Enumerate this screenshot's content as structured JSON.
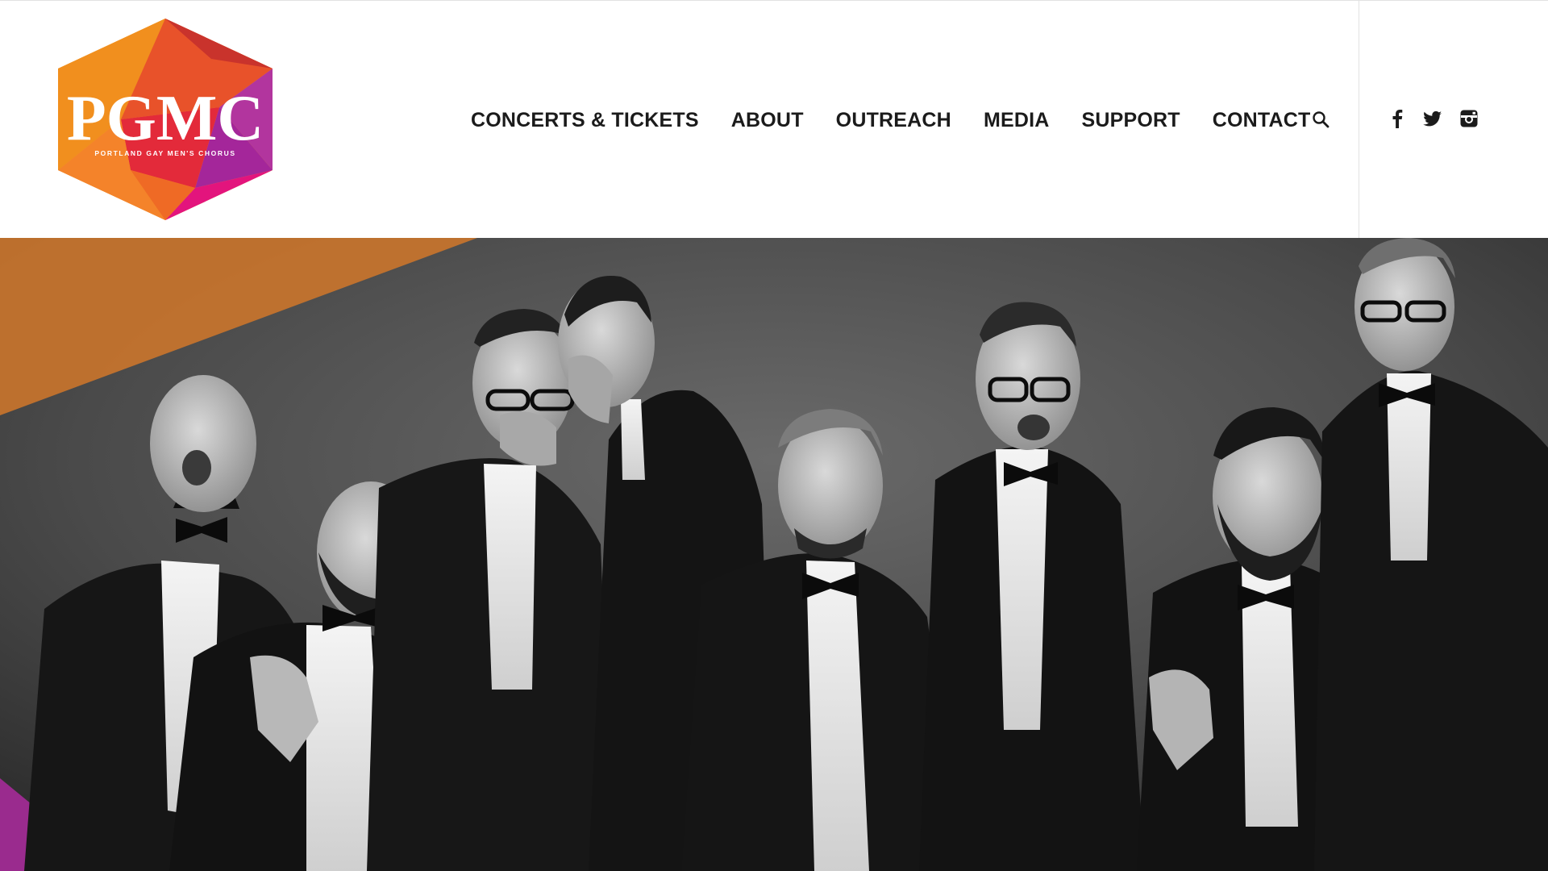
{
  "brand": {
    "logo_text": "PGMC",
    "logo_subtext": "PORTLAND GAY MEN'S CHORUS"
  },
  "nav": {
    "items": [
      {
        "label": "CONCERTS & TICKETS"
      },
      {
        "label": "ABOUT"
      },
      {
        "label": "OUTREACH"
      },
      {
        "label": "MEDIA"
      },
      {
        "label": "SUPPORT"
      },
      {
        "label": "CONTACT"
      }
    ],
    "search_icon": "search-icon"
  },
  "social": {
    "icons": [
      "facebook-icon",
      "twitter-icon",
      "instagram-icon"
    ]
  },
  "hero": {
    "image": "black-and-white group photo of eight men in tuxedos and bow ties, laughing",
    "accent_colors": [
      "#c8742c",
      "#9a2b8e",
      "#e01474"
    ]
  },
  "colors": {
    "nav_text": "#1b1b1b",
    "header_bg": "#ffffff",
    "divider": "#e2e2e2"
  }
}
